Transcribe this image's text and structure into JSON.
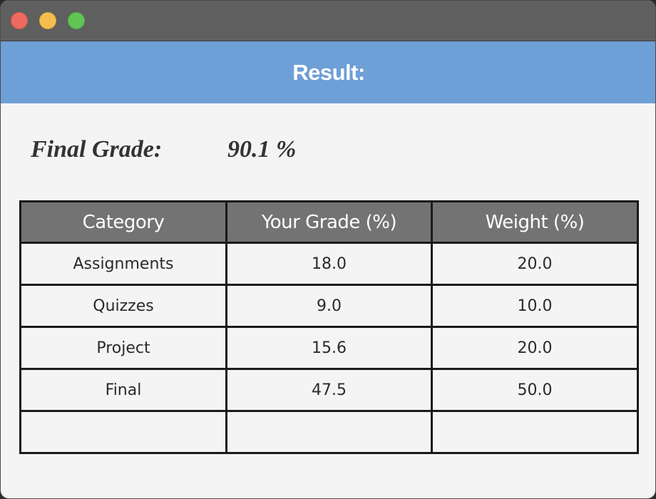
{
  "window": {
    "controls": {
      "close": "close-button",
      "minimize": "minimize-button",
      "maximize": "maximize-button"
    }
  },
  "header": {
    "title": "Result:"
  },
  "summary": {
    "final_grade_label": "Final Grade:",
    "final_grade_value": "90.1 %"
  },
  "table": {
    "columns": [
      "Category",
      "Your Grade (%)",
      "Weight (%)"
    ],
    "rows": [
      [
        "Assignments",
        "18.0",
        "20.0"
      ],
      [
        "Quizzes",
        "9.0",
        "10.0"
      ],
      [
        "Project",
        "15.6",
        "20.0"
      ],
      [
        "Final",
        "47.5",
        "50.0"
      ],
      [
        "",
        "",
        ""
      ]
    ]
  }
}
